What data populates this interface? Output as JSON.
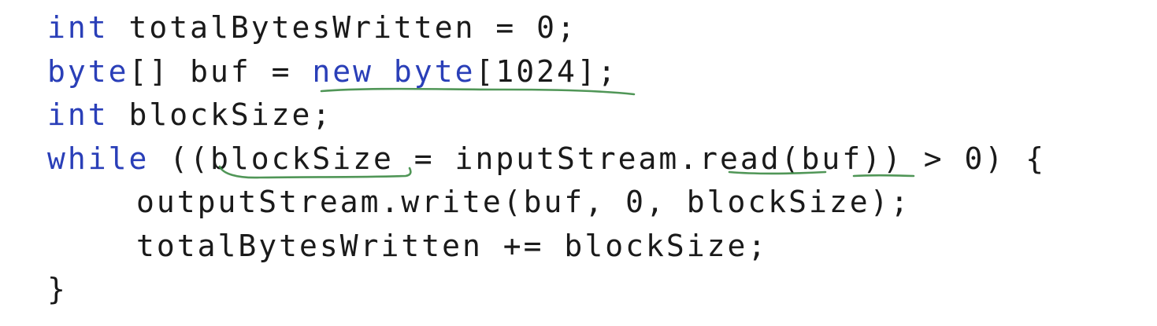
{
  "code": {
    "line1": {
      "keyword": "int",
      "rest": " totalBytesWritten = 0;"
    },
    "line2": {
      "keyword": "byte",
      "middle": "[] buf = ",
      "keyword2": "new byte",
      "rest": "[1024];"
    },
    "line3": {
      "keyword": "int",
      "rest": " blockSize;"
    },
    "line4": {
      "keyword": "while",
      "rest": " ((blockSize = inputStream.read(buf)) > 0) {"
    },
    "line5": {
      "rest": "outputStream.write(buf, 0, blockSize);"
    },
    "line6": {
      "rest": "totalBytesWritten += blockSize;"
    },
    "line7": {
      "rest": "}"
    }
  },
  "annotations": {
    "color": "#3d8b45",
    "marks": [
      "underline-new-byte",
      "underline-blockSize",
      "underline-dot-read",
      "underline-buf"
    ]
  },
  "colors": {
    "keyword": "#2a3fb8",
    "text": "#1a1a1a",
    "background": "#ffffff"
  }
}
